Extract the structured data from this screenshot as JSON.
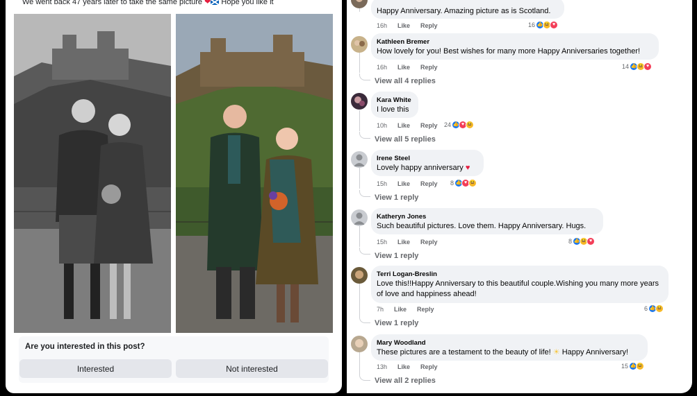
{
  "post": {
    "caption": "We went back 47 years later to take the same picture",
    "caption_tail": "Hope you like it"
  },
  "interest": {
    "question": "Are you interested in this post?",
    "interested_label": "Interested",
    "not_interested_label": "Not interested"
  },
  "comments": [
    {
      "name": "",
      "text": "Happy Anniversary. Amazing picture as is Scotland.",
      "time": "16h",
      "like": "Like",
      "reply": "Reply",
      "count": "16"
    },
    {
      "name": "Kathleen Bremer",
      "text": "How lovely for you! Best wishes for many more Happy Anniversaries together!",
      "time": "16h",
      "like": "Like",
      "reply": "Reply",
      "count": "14",
      "view": "View all 4 replies"
    },
    {
      "name": "Kara White",
      "text": "I love this",
      "time": "10h",
      "like": "Like",
      "reply": "Reply",
      "count": "24",
      "view": "View all 5 replies"
    },
    {
      "name": "Irene Steel",
      "text": "Lovely happy anniversary",
      "time": "15h",
      "like": "Like",
      "reply": "Reply",
      "count": "8",
      "view": "View 1 reply"
    },
    {
      "name": "Katheryn Jones",
      "text": "Such beautiful pictures. Love them. Happy Anniversary. Hugs.",
      "time": "15h",
      "like": "Like",
      "reply": "Reply",
      "count": "8",
      "view": "View 1 reply"
    },
    {
      "name": "Terri Logan-Breslin",
      "text": "Love this!!Happy Anniversary to this beautiful couple.Wishing you many more years of love and happiness ahead!",
      "time": "7h",
      "like": "Like",
      "reply": "Reply",
      "count": "6",
      "view": "View 1 reply"
    },
    {
      "name": "Mary Woodland",
      "text": "These pictures are a testament to the beauty of life!",
      "text_tail": "Happy Anniversary!",
      "time": "13h",
      "like": "Like",
      "reply": "Reply",
      "count": "15",
      "view": "View all 2 replies"
    }
  ],
  "colors": {
    "like": "#1877f2",
    "love": "#f33e58",
    "haha": "#f7b928",
    "bubble": "#f0f2f5",
    "meta": "#65676b"
  },
  "icons": [
    "like-icon",
    "love-icon",
    "haha-icon",
    "heart-emoji",
    "scotland-flag-icon",
    "sun-emoji",
    "default-avatar-icon"
  ]
}
